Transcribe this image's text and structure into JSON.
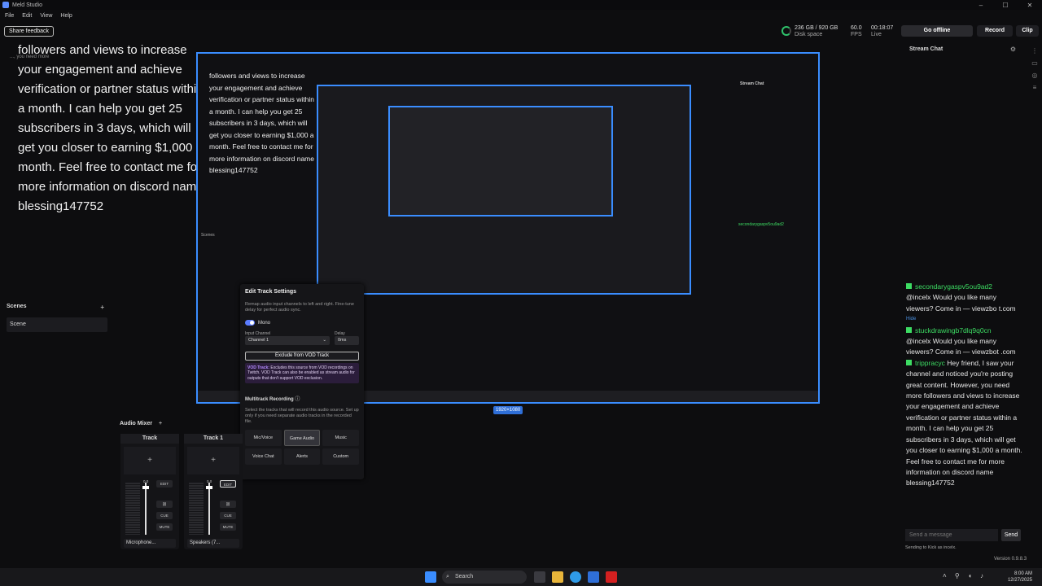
{
  "window": {
    "title": "Meld Studio",
    "min": "–",
    "max": "☐",
    "close": "✕"
  },
  "menu": [
    "File",
    "Edit",
    "View",
    "Help"
  ],
  "topbar": {
    "feedback": "Share feedback",
    "disk": {
      "value": "236 GB / 920 GB",
      "label": "Disk space"
    },
    "fps": {
      "value": "60.0",
      "label": "FPS"
    },
    "live": {
      "value": "00:18:07",
      "label": "Live"
    },
    "go_offline": "Go offline",
    "record": "Record",
    "clip": "Clip"
  },
  "overlay_text": "followers and views to increase your engagement and achieve verification or partner status within a month. I can help you get 25 subscribers in 3 days, which will get you closer to earning $1,000 a month. Feel free to contact me for more information on discord name blessing147752",
  "overlay_partial": "..., you need more",
  "scenes": {
    "title": "Scenes",
    "add": "+",
    "items": [
      "Scene"
    ]
  },
  "preview": {
    "resolution": "1920×1080",
    "inner_text": "followers and views to increase your engagement and achieve verification or partner status within a month. I can help you get 25 subscribers in 3 days, which will get you closer to earning $1,000 a month. Feel free to contact me for more information on discord name blessing147752",
    "chat_title": "Stream Chat",
    "chat_user": "secondarygaspv5ou9ad2"
  },
  "track_settings": {
    "title": "Edit Track Settings",
    "desc": "Remap audio input channels to left and right. Fine-tune delay for perfect audio sync.",
    "mono": "Mono",
    "input_channel_label": "Input Channel",
    "input_channel": "Channel 1",
    "delay_label": "Delay",
    "delay": "0ms",
    "exclude_button": "Exclude from VOD Track",
    "vod_title": "VOD Track:",
    "vod_text": "Excludes this source from VOD recordings on Twitch. VOD Track can also be enabled as stream audio for outputs that don't support VOD exclusion.",
    "multitrack_title": "Multitrack Recording",
    "multitrack_desc": "Select the tracks that will record this audio source. Set up only if you need separate audio tracks in the recorded file.",
    "tracks": [
      "Mic/Voice",
      "Game Audio",
      "Music",
      "Voice Chat",
      "Alerts",
      "Custom"
    ]
  },
  "mixer": {
    "title": "Audio Mixer",
    "add": "+",
    "strips": [
      {
        "name": "Track",
        "device": "Microphone...",
        "level": "0.0"
      },
      {
        "name": "Track 1",
        "device": "Speakers (7...",
        "level": "0.0"
      }
    ],
    "edit": "EDIT",
    "cue": "CUE",
    "mute": "MUTE"
  },
  "chat": {
    "title": "Stream Chat",
    "messages": [
      {
        "user": "secondarygaspv5ou9ad2",
        "text": "@incelx Would you like many viewers? Come in — viewzbo t.com"
      },
      {
        "user": "stuckdrawingb7dlq9q0cn",
        "text": "@incelx Would you like many viewers? Come in — viewzbot .com"
      },
      {
        "user": "trippracyc",
        "text": "Hey friend, I saw your channel and noticed you're posting great content. However, you need more followers and views to increase your engagement and achieve verification or partner status within a month. I can help you get 25 subscribers in 3 days, which will get you closer to earning $1,000 a month. Feel free to contact me for more information on discord name blessing147752"
      }
    ],
    "hide": "Hide",
    "input_placeholder": "Send a message",
    "send": "Send",
    "sending": "Sending to Kick as incelx."
  },
  "status": {
    "version": "Version 0.9.8.3"
  },
  "taskbar": {
    "search": "Search",
    "time": "8:00 AM",
    "date": "12/27/2025"
  }
}
